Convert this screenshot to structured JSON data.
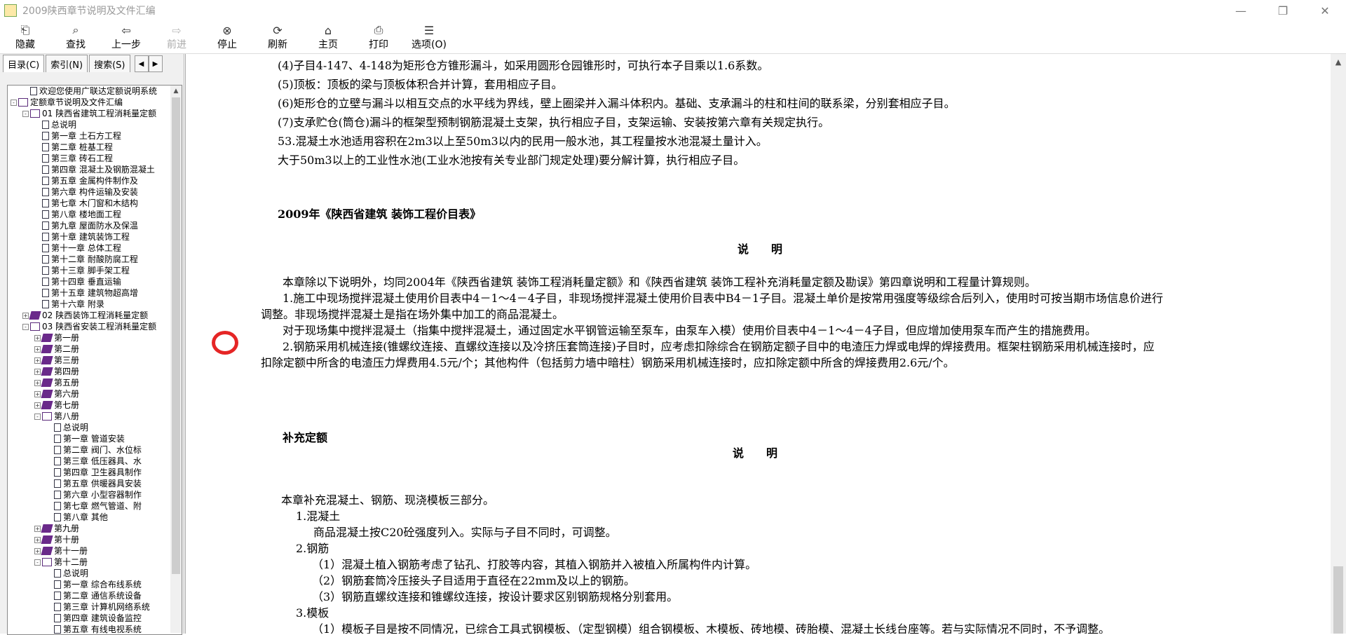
{
  "window": {
    "title": "2009陕西章节说明及文件汇编",
    "minimize_icon": "minimize-icon",
    "restore_icon": "restore-icon",
    "close_icon": "close-icon"
  },
  "toolbar": [
    {
      "label": "隐藏",
      "icon": "hide-icon",
      "glyph": "⎗",
      "enabled": true
    },
    {
      "label": "查找",
      "icon": "find-icon",
      "glyph": "⌕",
      "enabled": true
    },
    {
      "label": "上一步",
      "icon": "back-arrow-icon",
      "glyph": "⇦",
      "enabled": true
    },
    {
      "label": "前进",
      "icon": "forward-arrow-icon",
      "glyph": "⇨",
      "enabled": false
    },
    {
      "label": "停止",
      "icon": "stop-icon",
      "glyph": "⊗",
      "enabled": true
    },
    {
      "label": "刷新",
      "icon": "refresh-icon",
      "glyph": "⟳",
      "enabled": true
    },
    {
      "label": "主页",
      "icon": "home-icon",
      "glyph": "⌂",
      "enabled": true
    },
    {
      "label": "打印",
      "icon": "print-icon",
      "glyph": "⎙",
      "enabled": true
    },
    {
      "label": "选项(O)",
      "icon": "options-icon",
      "glyph": "☰",
      "enabled": true
    }
  ],
  "nav": {
    "tabs": [
      "目录(C)",
      "索引(N)",
      "搜索(S)"
    ],
    "tree": [
      {
        "level": 1,
        "exp": "",
        "icon": "doc",
        "label": "欢迎您使用广联达定额说明系统"
      },
      {
        "level": 0,
        "exp": "-",
        "icon": "book-open",
        "label": "定额章节说明及文件汇编"
      },
      {
        "level": 1,
        "exp": "-",
        "icon": "book-open",
        "label": "01 陕西省建筑工程消耗量定额"
      },
      {
        "level": 2,
        "exp": "",
        "icon": "doc",
        "label": "总说明"
      },
      {
        "level": 2,
        "exp": "",
        "icon": "doc",
        "label": "第一章 土石方工程"
      },
      {
        "level": 2,
        "exp": "",
        "icon": "doc",
        "label": "第二章 桩基工程"
      },
      {
        "level": 2,
        "exp": "",
        "icon": "doc",
        "label": "第三章 砖石工程"
      },
      {
        "level": 2,
        "exp": "",
        "icon": "doc",
        "label": "第四章 混凝土及钢筋混凝土"
      },
      {
        "level": 2,
        "exp": "",
        "icon": "doc",
        "label": "第五章 金属构件制作及"
      },
      {
        "level": 2,
        "exp": "",
        "icon": "doc",
        "label": "第六章 构件运输及安装"
      },
      {
        "level": 2,
        "exp": "",
        "icon": "doc",
        "label": "第七章 木门窗和木结构"
      },
      {
        "level": 2,
        "exp": "",
        "icon": "doc",
        "label": "第八章 楼地面工程"
      },
      {
        "level": 2,
        "exp": "",
        "icon": "doc",
        "label": "第九章 屋面防水及保温"
      },
      {
        "level": 2,
        "exp": "",
        "icon": "doc",
        "label": "第十章 建筑装饰工程"
      },
      {
        "level": 2,
        "exp": "",
        "icon": "doc",
        "label": "第十一章 总体工程"
      },
      {
        "level": 2,
        "exp": "",
        "icon": "doc",
        "label": "第十二章 耐酸防腐工程"
      },
      {
        "level": 2,
        "exp": "",
        "icon": "doc",
        "label": "第十三章 脚手架工程"
      },
      {
        "level": 2,
        "exp": "",
        "icon": "doc",
        "label": "第十四章 垂直运输"
      },
      {
        "level": 2,
        "exp": "",
        "icon": "doc",
        "label": "第十五章 建筑物超高增"
      },
      {
        "level": 2,
        "exp": "",
        "icon": "doc",
        "label": "第十六章 附录"
      },
      {
        "level": 1,
        "exp": "+",
        "icon": "book-closed",
        "label": "02 陕西装饰工程消耗量定额"
      },
      {
        "level": 1,
        "exp": "-",
        "icon": "book-open",
        "label": "03 陕西省安装工程消耗量定额"
      },
      {
        "level": 2,
        "exp": "+",
        "icon": "book-closed",
        "label": "第一册"
      },
      {
        "level": 2,
        "exp": "+",
        "icon": "book-closed",
        "label": "第二册"
      },
      {
        "level": 2,
        "exp": "+",
        "icon": "book-closed",
        "label": "第三册"
      },
      {
        "level": 2,
        "exp": "+",
        "icon": "book-closed",
        "label": "第四册"
      },
      {
        "level": 2,
        "exp": "+",
        "icon": "book-closed",
        "label": "第五册"
      },
      {
        "level": 2,
        "exp": "+",
        "icon": "book-closed",
        "label": "第六册"
      },
      {
        "level": 2,
        "exp": "+",
        "icon": "book-closed",
        "label": "第七册"
      },
      {
        "level": 2,
        "exp": "-",
        "icon": "book-open",
        "label": "第八册"
      },
      {
        "level": 3,
        "exp": "",
        "icon": "doc",
        "label": "总说明"
      },
      {
        "level": 3,
        "exp": "",
        "icon": "doc",
        "label": "第一章 管道安装"
      },
      {
        "level": 3,
        "exp": "",
        "icon": "doc",
        "label": "第二章 阀门、水位标"
      },
      {
        "level": 3,
        "exp": "",
        "icon": "doc",
        "label": "第三章 低压器具、水"
      },
      {
        "level": 3,
        "exp": "",
        "icon": "doc",
        "label": "第四章 卫生器具制作"
      },
      {
        "level": 3,
        "exp": "",
        "icon": "doc",
        "label": "第五章 供暖器具安装"
      },
      {
        "level": 3,
        "exp": "",
        "icon": "doc",
        "label": "第六章 小型容器制作"
      },
      {
        "level": 3,
        "exp": "",
        "icon": "doc",
        "label": "第七章 燃气管道、附"
      },
      {
        "level": 3,
        "exp": "",
        "icon": "doc",
        "label": "第八章 其他"
      },
      {
        "level": 2,
        "exp": "+",
        "icon": "book-closed",
        "label": "第九册"
      },
      {
        "level": 2,
        "exp": "+",
        "icon": "book-closed",
        "label": "第十册"
      },
      {
        "level": 2,
        "exp": "+",
        "icon": "book-closed",
        "label": "第十一册"
      },
      {
        "level": 2,
        "exp": "-",
        "icon": "book-open",
        "label": "第十二册"
      },
      {
        "level": 3,
        "exp": "",
        "icon": "doc",
        "label": "总说明"
      },
      {
        "level": 3,
        "exp": "",
        "icon": "doc",
        "label": "第一章 综合布线系统"
      },
      {
        "level": 3,
        "exp": "",
        "icon": "doc",
        "label": "第二章 通信系统设备"
      },
      {
        "level": 3,
        "exp": "",
        "icon": "doc",
        "label": "第三章 计算机网络系统"
      },
      {
        "level": 3,
        "exp": "",
        "icon": "doc",
        "label": "第四章 建筑设备监控"
      },
      {
        "level": 3,
        "exp": "",
        "icon": "doc",
        "label": "第五章 有线电视系统"
      }
    ]
  },
  "content": {
    "lines": [
      {
        "text": "(4)子目4-147、4-148为矩形仓方锥形漏斗，如采用圆形仓园锥形时，可执行本子目乘以1.6系数。",
        "bold": false
      },
      {
        "text": "(5)顶板：顶板的梁与顶板体积合并计算，套用相应子目。",
        "bold": false
      },
      {
        "text": "(6)矩形仓的立壁与漏斗以相互交点的水平线为界线，壁上圈梁并入漏斗体积内。基础、支承漏斗的柱和柱间的联系梁，分别套相应子目。",
        "bold": false
      },
      {
        "text": "(7)支承贮仓(筒仓)漏斗的框架型预制钢筋混凝土支架，执行相应子目，支架运输、安装按第六章有关规定执行。",
        "bold": false
      },
      {
        "text": "53.混凝土水池适用容积在2m3以上至50m3以内的民用一般水池，其工程量按水池混凝土量计入。",
        "bold": false
      },
      {
        "text": "大于50m3以上的工业性水池(工业水池按有关专业部门规定处理)要分解计算，执行相应子目。",
        "bold": false
      },
      {
        "text": "2009年《陕西省建筑 装饰工程价目表》",
        "bold": true
      },
      {
        "text": "说　　明",
        "bold": true
      },
      {
        "text": "本章除以下说明外，均同2004年《陕西省建筑 装饰工程消耗量定额》和《陕西省建筑 装饰工程补充消耗量定额及勘误》第四章说明和工程量计算规则。",
        "bold": false
      },
      {
        "text": "1.施工中现场搅拌混凝土使用价目表中4－1～4－4子目，非现场搅拌混凝土使用价目表中B4－1子目。混凝土单价是按常用强度等级综合后列入，使用时可按当期市场信息价进行",
        "bold": false
      },
      {
        "text": "调整。非现场搅拌混凝土是指在场外集中加工的商品混凝土。",
        "bold": false
      },
      {
        "text": "对于现场集中搅拌混凝土（指集中搅拌混凝土，通过固定水平钢管运输至泵车，由泵车入模）使用价目表中4－1～4－4子目，但应增加使用泵车而产生的措施费用。",
        "bold": false
      },
      {
        "text": "2.钢筋采用机械连接(锥螺纹连接、直螺纹连接以及冷挤压套筒连接)子目时，应考虑扣除综合在钢筋定额子目中的电渣压力焊或电焊的焊接费用。框架柱钢筋采用机械连接时，应",
        "bold": false
      },
      {
        "text": "扣除定额中所含的电渣压力焊费用4.5元/个；其他构件（包括剪力墙中暗柱）钢筋采用机械连接时，应扣除定额中所含的焊接费用2.6元/个。",
        "bold": false
      },
      {
        "text": "补充定额",
        "bold": true
      },
      {
        "text": "说　　明",
        "bold": true
      },
      {
        "text": "本章补充混凝土、钢筋、现浇模板三部分。",
        "bold": false
      },
      {
        "text": "1.混凝土",
        "bold": false
      },
      {
        "text": "商品混凝土按C20砼强度列入。实际与子目不同时，可调整。",
        "bold": false
      },
      {
        "text": "2.钢筋",
        "bold": false
      },
      {
        "text": "（1）混凝土植入钢筋考虑了钻孔、打胶等内容，其植入钢筋并入被植入所属构件内计算。",
        "bold": false
      },
      {
        "text": "（2）钢筋套筒冷压接头子目适用于直径在22mm及以上的钢筋。",
        "bold": false
      },
      {
        "text": "（3）钢筋直螺纹连接和锥螺纹连接，按设计要求区别钢筋规格分别套用。",
        "bold": false
      },
      {
        "text": "3.模板",
        "bold": false
      },
      {
        "text": "（1）模板子目是按不同情况，已综合工具式钢模板、（定型钢模）组合钢模板、木模板、砖地模、砖胎模、混凝土长线台座等。若与实际情况不同时，不予调整。",
        "bold": false
      }
    ]
  },
  "annotation": {
    "color": "#e52525"
  }
}
